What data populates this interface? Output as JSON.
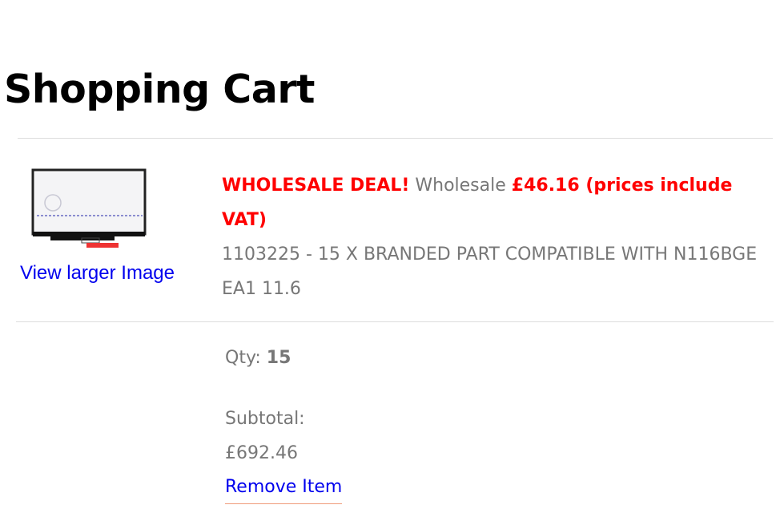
{
  "page": {
    "title": "Shopping Cart"
  },
  "item": {
    "image_link": "View larger Image",
    "deal_label": "WHOLESALE DEAL!",
    "wholesale_label": "Wholesale",
    "price": "£46.16 (prices include VAT)",
    "name": "1103225 - 15 X BRANDED PART COMPATIBLE WITH N116BGE EA1 11.6",
    "qty_label": "Qty:",
    "qty_value": "15",
    "subtotal_label": "Subtotal:",
    "subtotal_value": "£692.46",
    "remove_label": "Remove Item"
  },
  "colors": {
    "deal": "#ff0000",
    "link": "#0000ee",
    "muted_text": "#777777",
    "divider": "#dddddd"
  }
}
